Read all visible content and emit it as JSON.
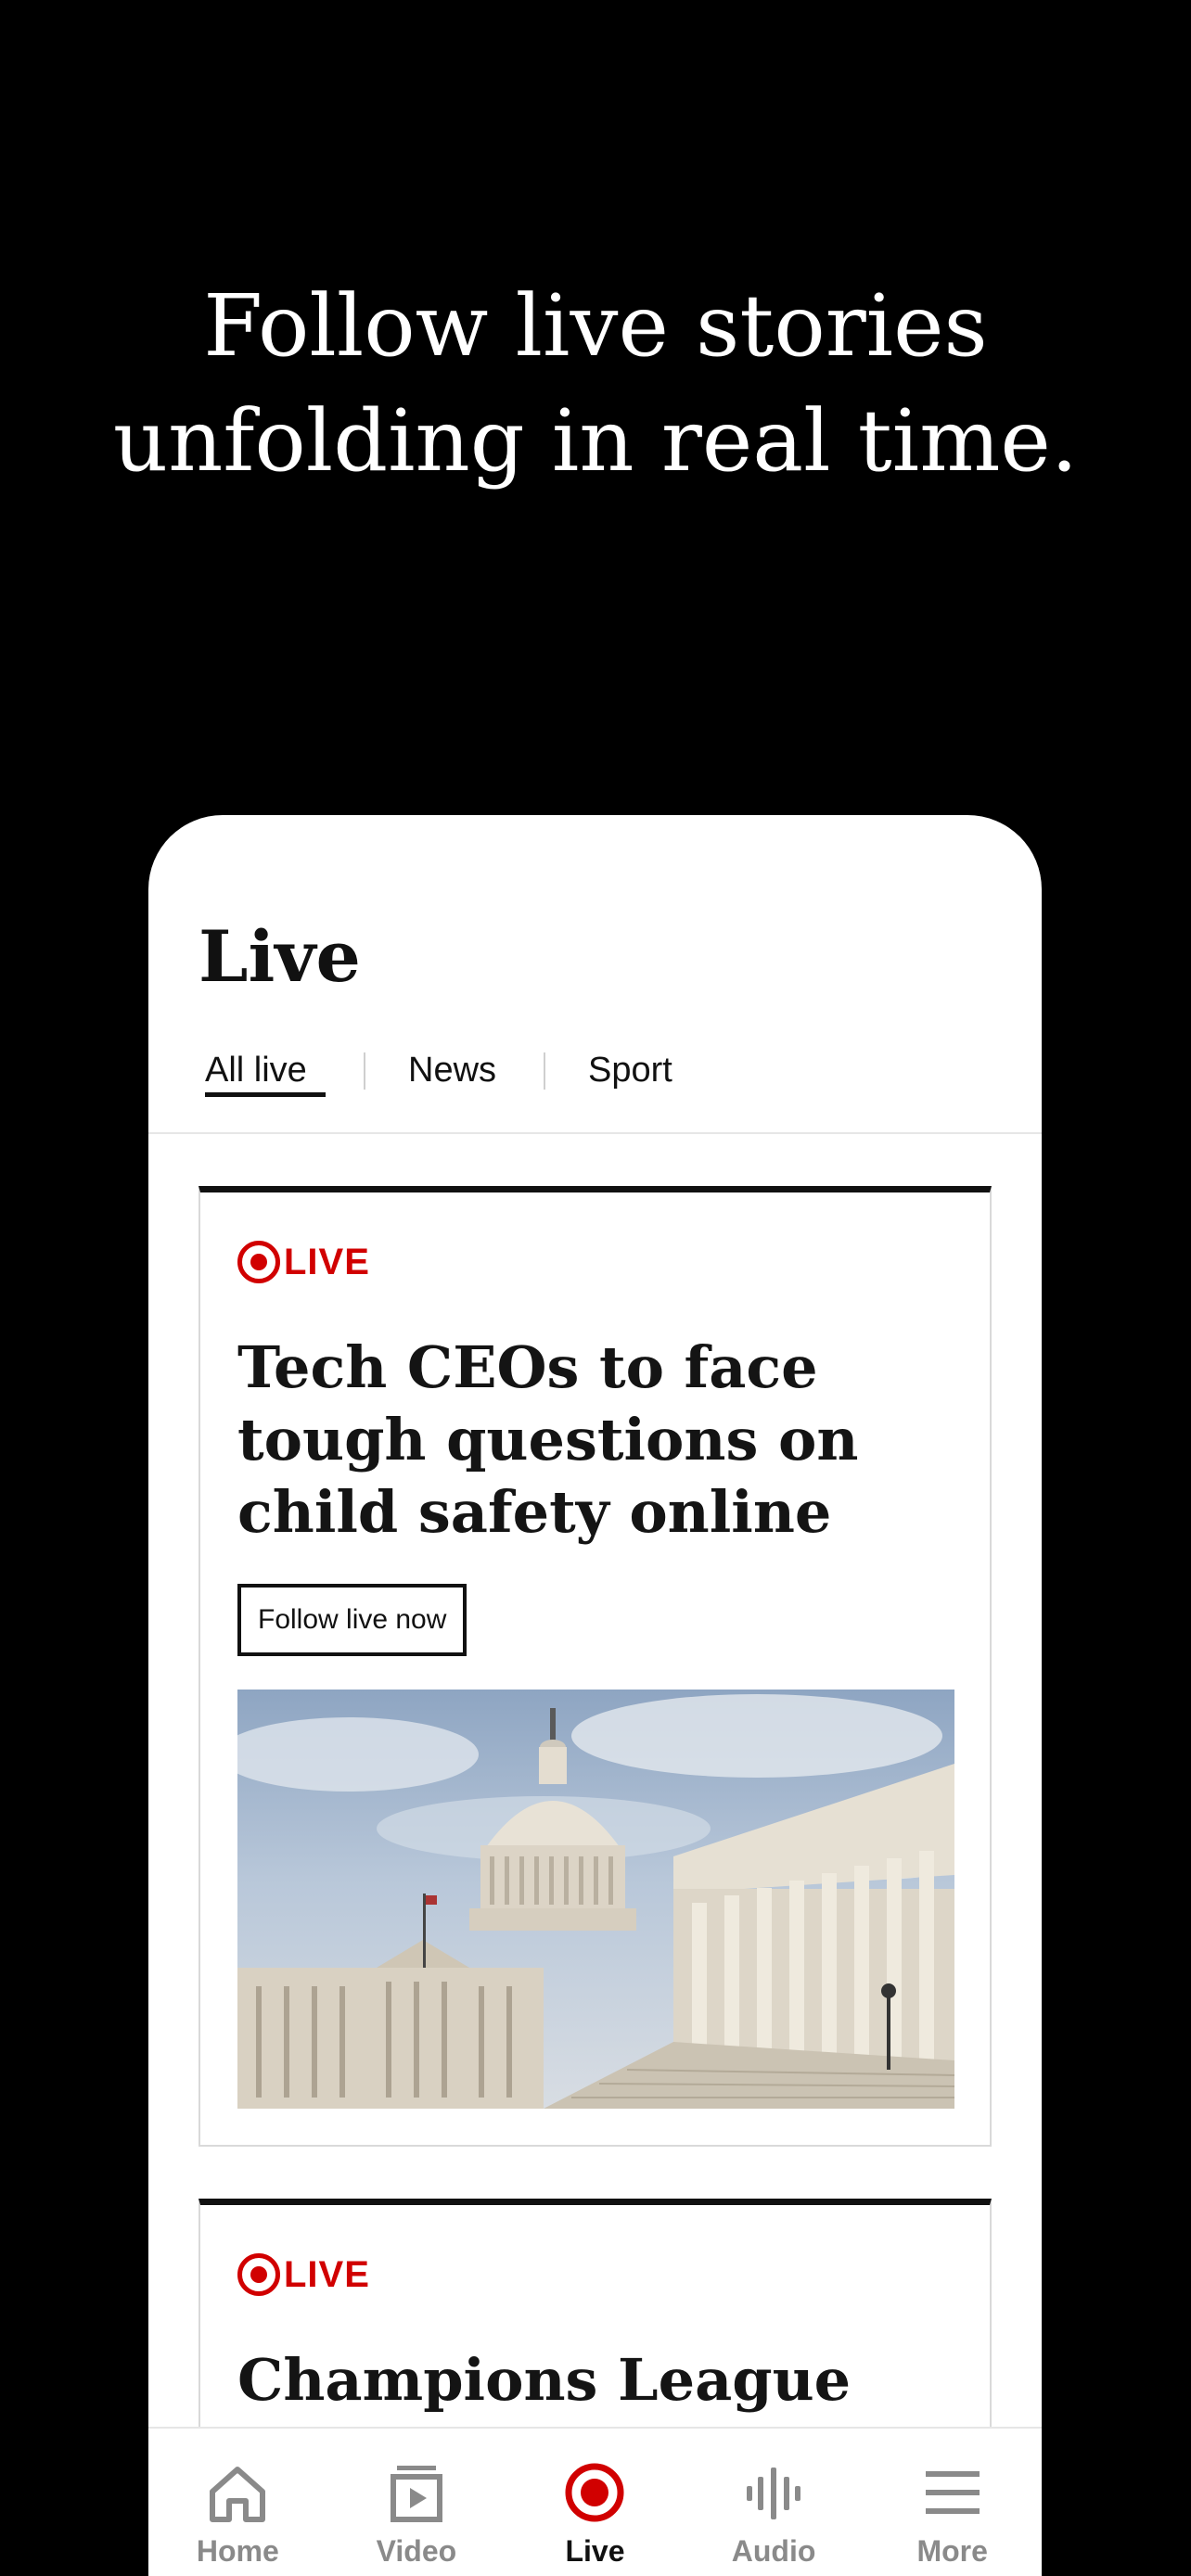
{
  "promo": {
    "headline_line1": "Follow live stories",
    "headline_line2": "unfolding in real time."
  },
  "screen": {
    "title": "Live",
    "tabs": [
      {
        "label": "All live",
        "active": true
      },
      {
        "label": "News",
        "active": false
      },
      {
        "label": "Sport",
        "active": false
      }
    ]
  },
  "cards": [
    {
      "badge": "LIVE",
      "headline": "Tech CEOs to face tough questions on child safety online",
      "button_label": "Follow live now",
      "image": "us-capitol-building"
    },
    {
      "badge": "LIVE",
      "headline": "Champions League"
    }
  ],
  "bottom_nav": [
    {
      "label": "Home",
      "icon": "home-icon",
      "active": false
    },
    {
      "label": "Video",
      "icon": "video-icon",
      "active": false
    },
    {
      "label": "Live",
      "icon": "live-icon",
      "active": true
    },
    {
      "label": "Audio",
      "icon": "audio-icon",
      "active": false
    },
    {
      "label": "More",
      "icon": "menu-icon",
      "active": false
    }
  ],
  "colors": {
    "background": "#000000",
    "live_red": "#d10000",
    "text": "#111111",
    "inactive_nav": "#8a8a8a"
  }
}
